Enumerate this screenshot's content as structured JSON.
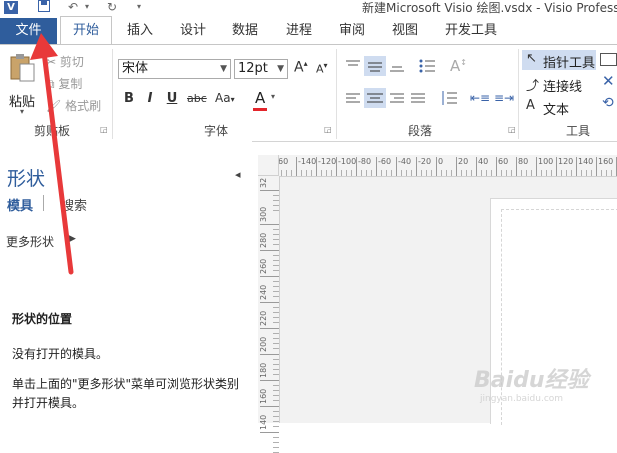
{
  "title": "新建Microsoft Visio 绘图.vsdx - Visio Profess",
  "tabs": {
    "file": "文件",
    "home": "开始",
    "insert": "插入",
    "design": "设计",
    "data": "数据",
    "process": "进程",
    "review": "审阅",
    "view": "视图",
    "developer": "开发工具"
  },
  "clipboard": {
    "paste": "粘贴",
    "cut": "剪切",
    "copy": "复制",
    "format_painter": "格式刷",
    "label": "剪贴板"
  },
  "font": {
    "name": "宋体",
    "size": "12pt",
    "label": "字体",
    "bold": "B",
    "italic": "I",
    "underline": "U",
    "strikethrough": "abc",
    "case": "Aa",
    "color_letter": "A"
  },
  "paragraph": {
    "label": "段落"
  },
  "tools": {
    "pointer": "指针工具",
    "connector": "连接线",
    "text": "文本",
    "label": "工具"
  },
  "shapes_panel": {
    "title": "形状",
    "tab_stencils": "模具",
    "tab_search": "搜索",
    "more_shapes": "更多形状",
    "section_title": "形状的位置",
    "no_stencils": "没有打开的模具。",
    "hint": "单击上面的\"更多形状\"菜单可浏览形状类别并打开模具。"
  },
  "ruler": {
    "top_ticks": [
      "60",
      "-140",
      "-120",
      "-100",
      "-80",
      "-60",
      "-40",
      "-20",
      "0",
      "20",
      "40",
      "60",
      "80",
      "100",
      "120",
      "140",
      "160",
      "18"
    ],
    "left_ticks": [
      "32",
      "300",
      "280",
      "260",
      "240",
      "220",
      "200",
      "180",
      "160",
      "140"
    ]
  },
  "watermark": {
    "brand": "Baidu经验",
    "url": "jingyan.baidu.com"
  },
  "colors": {
    "file_tab": "#2f5d9c",
    "arrow": "#e8393a",
    "font_color_bar": "#e3252b"
  }
}
